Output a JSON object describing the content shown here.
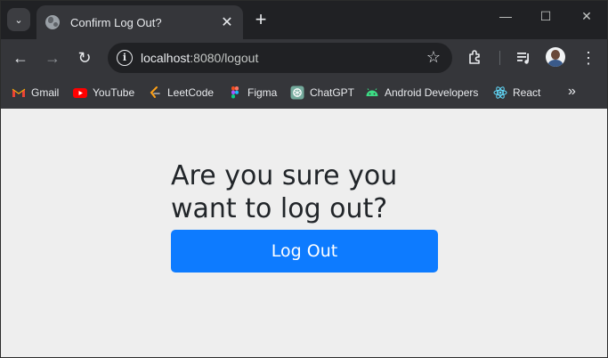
{
  "browser": {
    "tab": {
      "title": "Confirm Log Out?",
      "favicon": "globe-icon",
      "close_glyph": "✕"
    },
    "newtab_glyph": "+",
    "window_controls": {
      "minimize": "—",
      "maximize": "☐",
      "close": "✕"
    },
    "toolbar": {
      "back": "←",
      "forward": "→",
      "reload": "↻",
      "url_host": "localhost",
      "url_rest": ":8080/logout",
      "star": "☆"
    },
    "bookmarks": [
      {
        "label": "Gmail",
        "icon": "gmail-icon",
        "color": "#ea4335"
      },
      {
        "label": "YouTube",
        "icon": "youtube-icon",
        "color": "#ff0000"
      },
      {
        "label": "LeetCode",
        "icon": "leetcode-icon",
        "color": "#ffa116"
      },
      {
        "label": "Figma",
        "icon": "figma-icon",
        "color": "#f24e1e"
      },
      {
        "label": "ChatGPT",
        "icon": "chatgpt-icon",
        "color": "#74aa9c"
      },
      {
        "label": "Android Developers",
        "icon": "android-icon",
        "color": "#3ddc84"
      },
      {
        "label": "React",
        "icon": "react-icon",
        "color": "#61dafb"
      }
    ],
    "bookmarks_more": "»"
  },
  "page": {
    "heading": "Are you sure you want to log out?",
    "logout_button": "Log Out"
  },
  "colors": {
    "accent": "#0d7bff",
    "page_bg": "#eeeeee",
    "chrome_bg": "#35363a",
    "tabstrip_bg": "#202124"
  }
}
